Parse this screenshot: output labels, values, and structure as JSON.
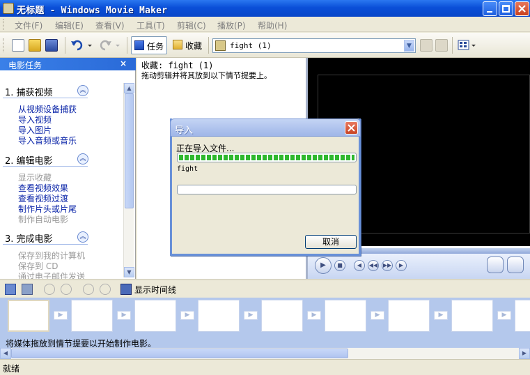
{
  "window": {
    "title": "无标题 - Windows Movie Maker"
  },
  "menu": [
    "文件(F)",
    "编辑(E)",
    "查看(V)",
    "工具(T)",
    "剪辑(C)",
    "播放(P)",
    "帮助(H)"
  ],
  "toolbar": {
    "tasks_label": "任务",
    "collections_label": "收藏",
    "collection_value": "fight (1)"
  },
  "task_pane": {
    "title": "电影任务",
    "close": "×",
    "sections": [
      {
        "title": "1. 捕获视频",
        "links": [
          {
            "label": "从视频设备捕获",
            "enabled": true
          },
          {
            "label": "导入视频",
            "enabled": true
          },
          {
            "label": "导入图片",
            "enabled": true
          },
          {
            "label": "导入音频或音乐",
            "enabled": true
          }
        ]
      },
      {
        "title": "2. 编辑电影",
        "links": [
          {
            "label": "显示收藏",
            "enabled": false
          },
          {
            "label": "查看视频效果",
            "enabled": true
          },
          {
            "label": "查看视频过渡",
            "enabled": true
          },
          {
            "label": "制作片头或片尾",
            "enabled": true
          },
          {
            "label": "制作自动电影",
            "enabled": false
          }
        ]
      },
      {
        "title": "3. 完成电影",
        "links": [
          {
            "label": "保存到我的计算机",
            "enabled": false
          },
          {
            "label": "保存到 CD",
            "enabled": false
          },
          {
            "label": "通过电子邮件发送",
            "enabled": false
          }
        ]
      }
    ]
  },
  "content": {
    "title": "收藏: fight (1)",
    "hint": "拖动剪辑并将其放到以下情节提要上。"
  },
  "storyboard": {
    "show_timeline_label": "显示时间线",
    "hint": "将媒体拖放到情节提要以开始制作电影。"
  },
  "status": {
    "text": "就绪"
  },
  "dialog": {
    "title": "导入",
    "message": "正在导入文件...",
    "filename": "fight",
    "progress": 1.0,
    "cancel_label": "取消"
  },
  "colors": {
    "titlebar": "#0a4fd8",
    "progress_fill": "#2eb82e",
    "storyboard_bg": "#b4c8ec"
  }
}
